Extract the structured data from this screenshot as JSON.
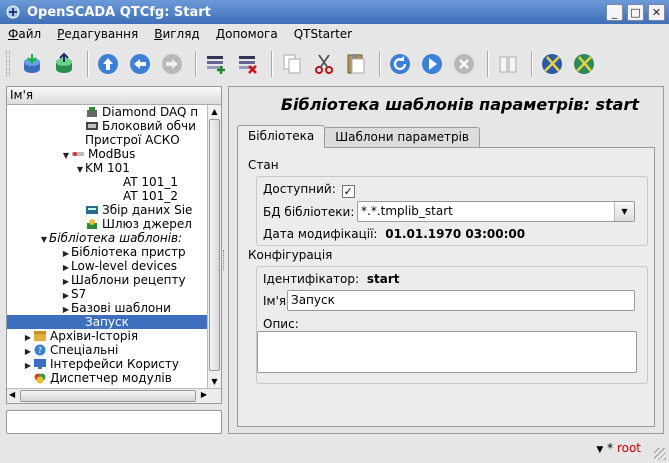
{
  "window": {
    "title": "OpenSCADA QTCfg: Start"
  },
  "menu": [
    {
      "label": "Файл",
      "u": "Ф",
      "rest": "айл"
    },
    {
      "label": "Редагування",
      "u": "Р",
      "rest": "едагування"
    },
    {
      "label": "Вигляд",
      "u": "В",
      "rest": "игляд"
    },
    {
      "label": "Допомога",
      "u": "Д",
      "rest": "опомога"
    },
    {
      "label": "QTStarter",
      "u": "",
      "rest": "QTStarter"
    }
  ],
  "tree": {
    "header": "Ім'я",
    "rows": [
      {
        "indent": 80,
        "arrow": "",
        "icon": "daq",
        "label": "Diamond DAQ п"
      },
      {
        "indent": 80,
        "arrow": "",
        "icon": "block",
        "label": "Блоковий обчи"
      },
      {
        "indent": 80,
        "arrow": "",
        "icon": "none",
        "label": "Пристрої АСКО"
      },
      {
        "indent": 66,
        "arrow": "▼",
        "icon": "modbus",
        "label": "ModBus"
      },
      {
        "indent": 80,
        "arrow": "▼",
        "icon": "none",
        "label": "KM 101"
      },
      {
        "indent": 118,
        "arrow": "",
        "icon": "none",
        "label": "AT 101_1"
      },
      {
        "indent": 118,
        "arrow": "",
        "icon": "none",
        "label": "AT 101_2"
      },
      {
        "indent": 80,
        "arrow": "",
        "icon": "siemens",
        "label": "Збір даних Sie"
      },
      {
        "indent": 80,
        "arrow": "",
        "icon": "gate",
        "label": "Шлюз джерел"
      },
      {
        "indent": 44,
        "arrow": "▼",
        "icon": "none",
        "label": "Бібліотека шаблонів:",
        "italic": true
      },
      {
        "indent": 66,
        "arrow": "▶",
        "icon": "none",
        "label": "Бібліотека пристр"
      },
      {
        "indent": 66,
        "arrow": "▶",
        "icon": "none",
        "label": "Low-level devices"
      },
      {
        "indent": 66,
        "arrow": "▶",
        "icon": "none",
        "label": "Шаблони рецепту"
      },
      {
        "indent": 66,
        "arrow": "▶",
        "icon": "none",
        "label": "S7"
      },
      {
        "indent": 66,
        "arrow": "▶",
        "icon": "none",
        "label": "Базові шаблони"
      },
      {
        "indent": 80,
        "arrow": "",
        "icon": "none",
        "label": "Запуск",
        "selected": true
      },
      {
        "indent": 28,
        "arrow": "▶",
        "icon": "archive",
        "label": "Архіви-Історія"
      },
      {
        "indent": 28,
        "arrow": "▶",
        "icon": "help",
        "label": "Спеціальні"
      },
      {
        "indent": 28,
        "arrow": "▶",
        "icon": "ui",
        "label": "Інтерфейси Користу"
      },
      {
        "indent": 28,
        "arrow": "",
        "icon": "modules",
        "label": "Диспетчер модулів"
      }
    ]
  },
  "panel": {
    "title": "Бібліотека шаблонів параметрів: start",
    "tabs": [
      "Бібліотека",
      "Шаблони параметрів"
    ],
    "state_group": "Стан",
    "available_label": "Доступний:",
    "available_checked": "✓",
    "db_label": "БД бібліотеки:",
    "db_value": "*.*.tmplib_start",
    "mod_label": "Дата модифікації:",
    "mod_value": "01.01.1970 03:00:00",
    "config_group": "Конфігурація",
    "id_label": "Ідентифікатор:",
    "id_value": "start",
    "name_label": "Ім'я:",
    "name_value": "Запуск",
    "descr_label": "Опис:"
  },
  "status": {
    "user": "root",
    "prefix": "*"
  }
}
